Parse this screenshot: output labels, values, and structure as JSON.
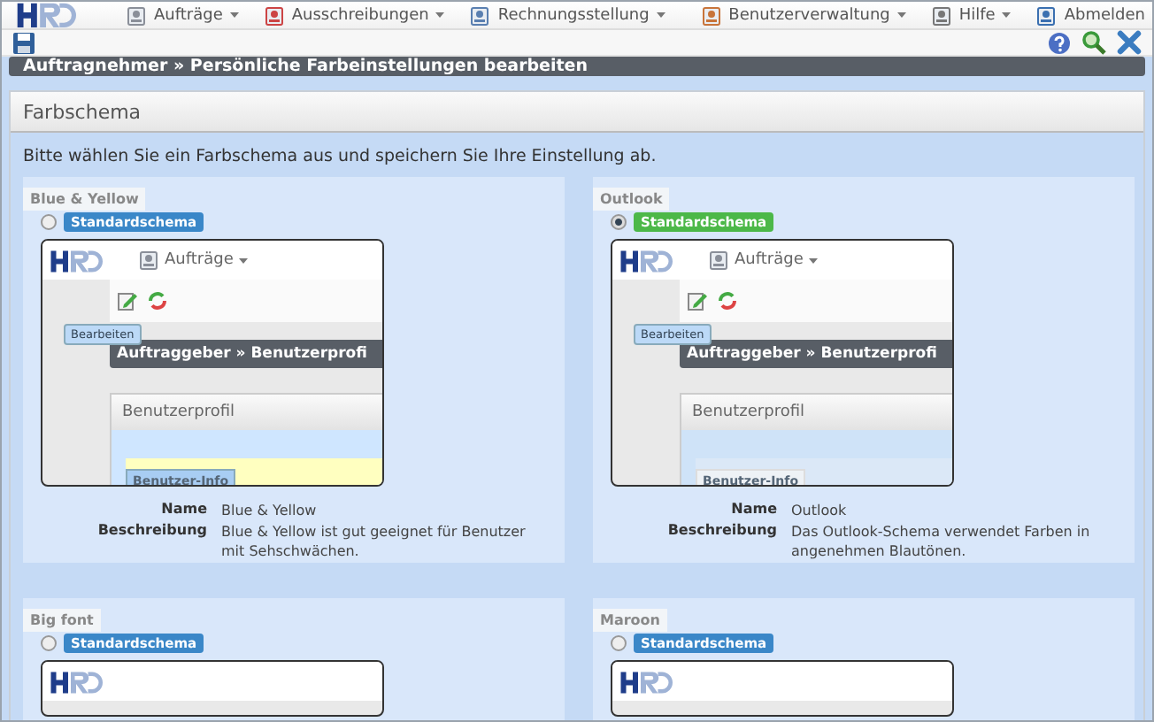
{
  "nav": {
    "left": [
      {
        "label": "Aufträge",
        "kind": "orders"
      },
      {
        "label": "Ausschreibungen",
        "kind": "tender"
      },
      {
        "label": "Rechnungsstellung",
        "kind": "billing"
      }
    ],
    "right": [
      {
        "label": "Benutzerverwaltung",
        "kind": "users",
        "menu": true
      },
      {
        "label": "Hilfe",
        "kind": "help",
        "menu": true
      },
      {
        "label": "Abmelden",
        "kind": "logout",
        "menu": false
      }
    ]
  },
  "page_title": "Auftragnehmer » Persönliche Farbeinstellungen bearbeiten",
  "panel": {
    "title": "Farbschema",
    "intro": "Bitte wählen Sie ein Farbschema aus und speichern Sie Ihre Einstellung ab.",
    "schemes": [
      {
        "title": "Blue & Yellow",
        "selected": false,
        "badge": "Standardschema",
        "color": "#3a87c8",
        "preview": {
          "kind": "yellow",
          "menu": "Aufträge",
          "tooltip": "Bearbeiten",
          "heading": "Auftraggeber » Benutzerprofi",
          "panel": "Benutzerprofil",
          "legend": "Benutzer-Info"
        },
        "name_label": "Name",
        "name": "Blue & Yellow",
        "desc_label": "Beschreibung",
        "desc": "Blue & Yellow ist gut geeignet für Benutzer mit Sehschwächen."
      },
      {
        "title": "Outlook",
        "selected": true,
        "badge": "Standardschema",
        "color": "#4cb848",
        "preview": {
          "kind": "blue",
          "menu": "Aufträge",
          "tooltip": "Bearbeiten",
          "heading": "Auftraggeber » Benutzerprofi",
          "panel": "Benutzerprofil",
          "legend": "Benutzer-Info"
        },
        "name_label": "Name",
        "name": "Outlook",
        "desc_label": "Beschreibung",
        "desc": "Das Outlook-Schema verwendet Farben in angenehmen Blautönen."
      },
      {
        "title": "Big font",
        "selected": false,
        "badge": "Standardschema",
        "color": "#3a87c8"
      },
      {
        "title": "Maroon",
        "selected": false,
        "badge": "Standardschema",
        "color": "#3a87c8"
      }
    ]
  }
}
